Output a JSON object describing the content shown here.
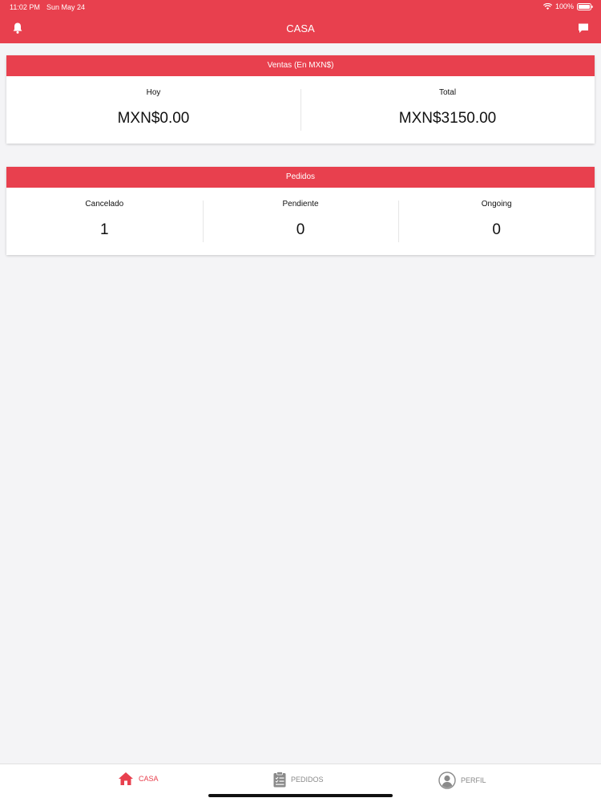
{
  "status_bar": {
    "time": "11:02 PM",
    "date": "Sun May 24",
    "battery": "100%"
  },
  "header": {
    "title": "CASA",
    "bell_icon": "bell-icon",
    "chat_icon": "chat-icon"
  },
  "ventas": {
    "title": "Ventas (En MXN$)",
    "stats": [
      {
        "label": "Hoy",
        "value": "MXN$0.00"
      },
      {
        "label": "Total",
        "value": "MXN$3150.00"
      }
    ]
  },
  "pedidos": {
    "title": "Pedidos",
    "stats": [
      {
        "label": "Cancelado",
        "value": "1"
      },
      {
        "label": "Pendiente",
        "value": "0"
      },
      {
        "label": "Ongoing",
        "value": "0"
      }
    ]
  },
  "tabbar": {
    "tabs": [
      {
        "label": "CASA",
        "icon": "home-icon",
        "active": true
      },
      {
        "label": "PEDIDOS",
        "icon": "clipboard-icon",
        "active": false
      },
      {
        "label": "PERFIL",
        "icon": "user-icon",
        "active": false
      }
    ]
  },
  "colors": {
    "accent": "#e8404e",
    "background": "#f4f4f6",
    "inactive_tab": "#8a8a8a"
  }
}
